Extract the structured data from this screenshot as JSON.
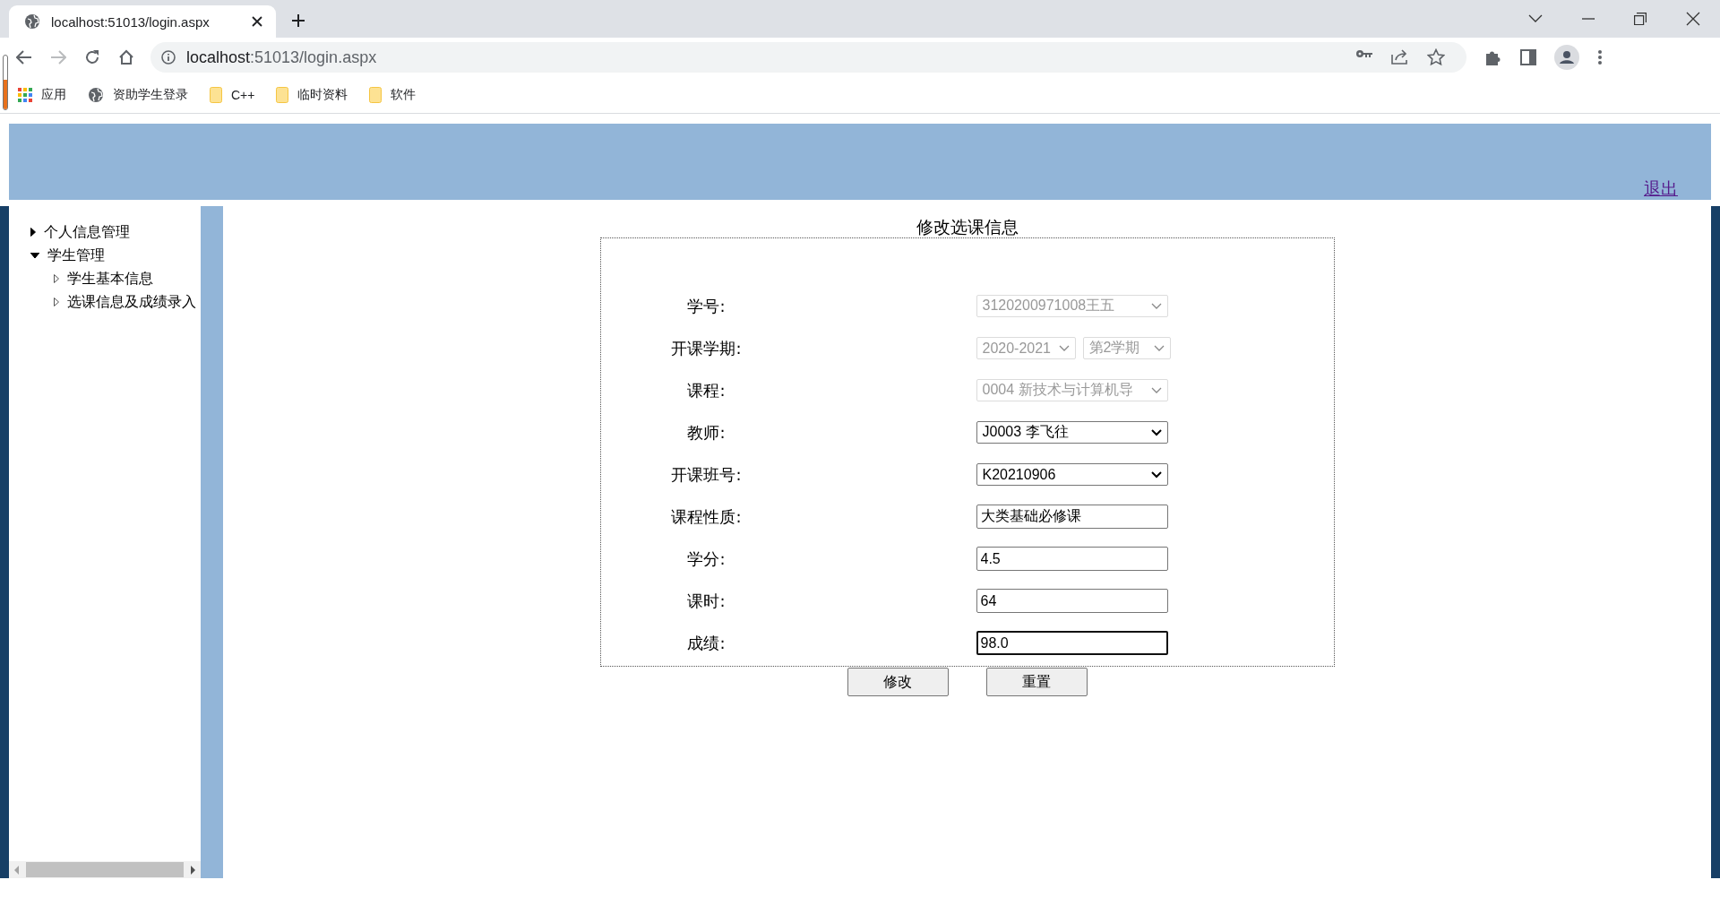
{
  "browser": {
    "tab_title": "localhost:51013/login.aspx",
    "address": {
      "host": "localhost",
      "path": ":51013/login.aspx"
    },
    "bookmarks": [
      {
        "label": "应用",
        "kind": "apps"
      },
      {
        "label": "资助学生登录",
        "kind": "site"
      },
      {
        "label": "C++",
        "kind": "folder"
      },
      {
        "label": "临时资料",
        "kind": "folder"
      },
      {
        "label": "软件",
        "kind": "folder"
      }
    ]
  },
  "header": {
    "logout_link": "退出"
  },
  "sidebar": {
    "items": [
      {
        "label": "个人信息管理",
        "expanded": false
      },
      {
        "label": "学生管理",
        "expanded": true,
        "children": [
          {
            "label": "学生基本信息",
            "expanded": false
          },
          {
            "label": "选课信息及成绩录入",
            "expanded": false
          }
        ]
      }
    ]
  },
  "form": {
    "title": "修改选课信息",
    "fields": [
      {
        "label": "学号:",
        "controls": [
          {
            "kind": "select",
            "value": "3120200971008王五",
            "disabled": true,
            "focused": false
          }
        ]
      },
      {
        "label": "开课学期:",
        "controls": [
          {
            "kind": "select",
            "value": "2020-2021",
            "disabled": true,
            "focused": false
          },
          {
            "kind": "select",
            "value": "第2学期",
            "disabled": true,
            "focused": false
          }
        ]
      },
      {
        "label": "课程:",
        "controls": [
          {
            "kind": "select",
            "value": "0004 新技术与计算机导",
            "disabled": true,
            "focused": false
          }
        ]
      },
      {
        "label": "教师:",
        "controls": [
          {
            "kind": "select",
            "value": "J0003 李飞往",
            "disabled": false,
            "focused": false
          }
        ]
      },
      {
        "label": "开课班号:",
        "controls": [
          {
            "kind": "select",
            "value": "K20210906",
            "disabled": false,
            "focused": false
          }
        ]
      },
      {
        "label": "课程性质:",
        "controls": [
          {
            "kind": "text",
            "value": "大类基础必修课",
            "disabled": false,
            "focused": false
          }
        ]
      },
      {
        "label": "学分:",
        "controls": [
          {
            "kind": "text",
            "value": "4.5",
            "disabled": false,
            "focused": false
          }
        ]
      },
      {
        "label": "课时:",
        "controls": [
          {
            "kind": "text",
            "value": "64",
            "disabled": false,
            "focused": false
          }
        ]
      },
      {
        "label": "成绩:",
        "controls": [
          {
            "kind": "text",
            "value": "98.0",
            "disabled": false,
            "focused": true
          }
        ]
      }
    ],
    "buttons": [
      "修改",
      "重置"
    ]
  }
}
